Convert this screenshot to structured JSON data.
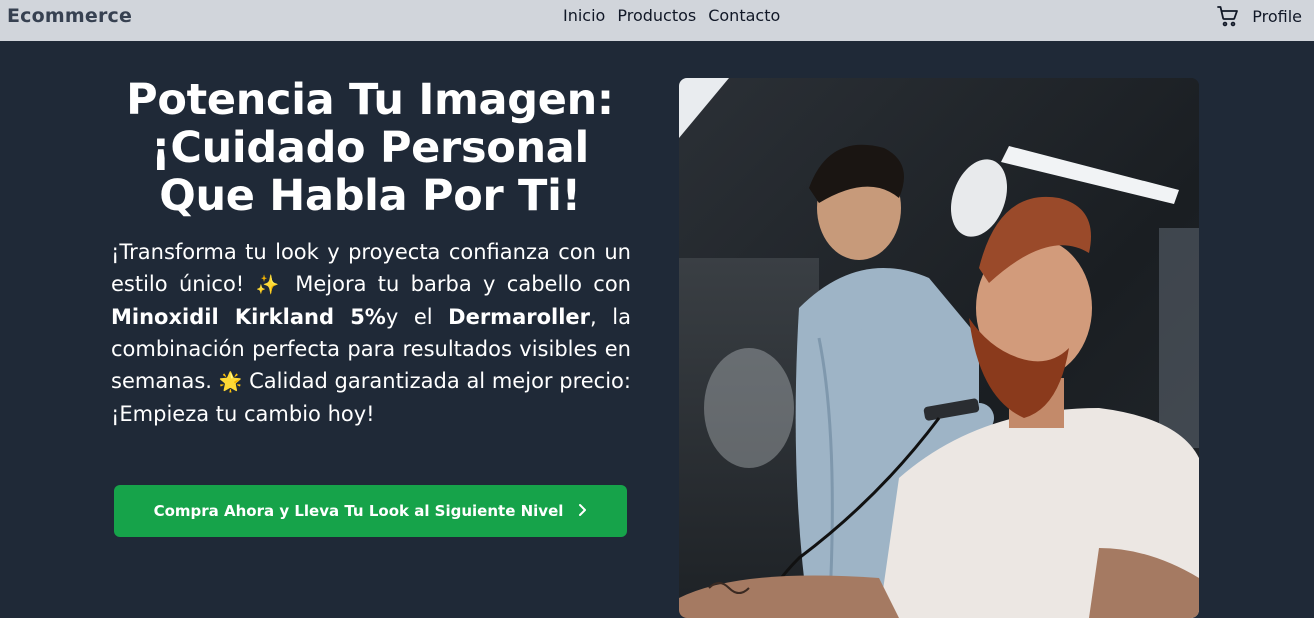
{
  "navbar": {
    "brand": "Ecommerce",
    "links": [
      "Inicio",
      "Productos",
      "Contacto"
    ],
    "profile": "Profile",
    "cart_icon": "shopping-cart-icon"
  },
  "hero": {
    "title_line1": "Potencia Tu Imagen:",
    "title_line2": "¡Cuidado Personal",
    "title_line3": "Que Habla Por Ti!",
    "text_1": "¡Transforma tu look y proyecta confianza con un estilo único!",
    "emoji_1": "✨",
    "text_2": " Mejora tu barba y cabello con ",
    "product_1": "Minoxidil Kirkland 5%",
    "text_3": "y el ",
    "product_2": "Dermaroller",
    "text_4": ", la combinación perfecta para resultados visibles en semanas.",
    "emoji_2": "🌟",
    "text_5": " Calidad garantizada al mejor precio: ¡Empieza tu cambio hoy!",
    "cta_label": "Compra Ahora y Lleva Tu Look al Siguiente Nivel",
    "cta_icon": "chevron-right-icon"
  },
  "image": {
    "subject": "barber-trimming-beard-photo"
  },
  "colors": {
    "background": "#1f2937",
    "navbar": "#d1d5db",
    "cta": "#16a34a"
  }
}
